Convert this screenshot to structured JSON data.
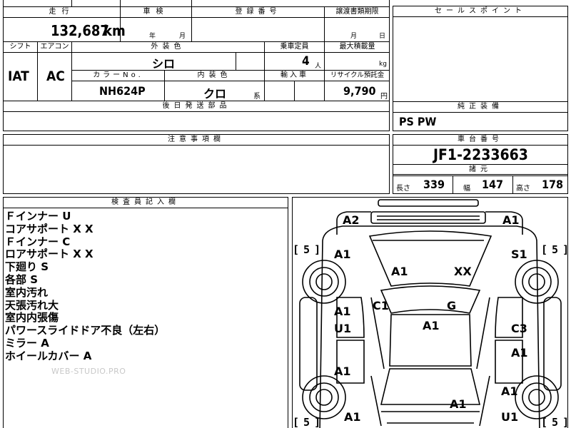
{
  "sheet": {
    "labels": {
      "mileage": "走行",
      "inspection": "車検",
      "registration": "登録番号",
      "transfer_deadline": "譲渡書類期限",
      "sales_point": "セールスポイント",
      "shift": "シフト",
      "aircon": "エアコン",
      "exterior_color": "外装色",
      "capacity": "乗車定員",
      "max_load": "最大積載量",
      "color_no": "カラーNo.",
      "interior_color": "内装色",
      "import": "輸入車",
      "recycle": "リサイクル預託金",
      "later_parts": "後日発送部品",
      "equipment": "純正装備",
      "notes": "注意事項欄",
      "chassis": "車台番号",
      "specs": "諸元",
      "inspector": "検査員記入欄"
    },
    "units": {
      "year": "年",
      "month": "月",
      "month2": "月",
      "day": "日",
      "persons": "人",
      "kg": "kg",
      "yen": "円",
      "series": "系",
      "length": "長さ",
      "width": "幅",
      "height": "高さ"
    },
    "values": {
      "mileage": "132,687",
      "mileage_unit": "km",
      "shift": "IAT",
      "aircon": "AC",
      "exterior_color": "シロ",
      "capacity": "4",
      "color_no": "NH624P",
      "interior_color": "クロ",
      "recycle": "9,790",
      "equipment": "PS PW",
      "chassis": "JF1-2233663",
      "length": "339",
      "width": "147",
      "height": "178"
    },
    "remarks": [
      "Ｆインナー U",
      "コアサポート X X",
      "Ｆインナー C",
      "ロアサポート X X",
      "下廻り S",
      "各部 S",
      "室内汚れ",
      "天張汚れ大",
      "室内内張傷",
      "パワースライドドア不良（左右）",
      "ミラー A",
      "ホイールカバー A"
    ],
    "watermark": "WEB-STUDIO.PRO"
  },
  "diagram": {
    "marks": {
      "front_left": "A2",
      "front_right": "A1",
      "hood": "A1",
      "hood_right": "XX",
      "lf_fender": "A1",
      "rf_fender": "S1",
      "left_pillar": "C1",
      "windshield": "G",
      "roof": "A1",
      "lf_door": "A1",
      "lf_door2": "U1",
      "rf_door": "C3",
      "lr_door": "A1",
      "rr_door": "A1",
      "rr_quarter": "A1",
      "rear_glass": "A1",
      "lr_quarter": "A1",
      "rear_right": "U1"
    },
    "tire_left_top": "5",
    "tire_right_top": "5",
    "tire_left_bottom": "5",
    "tire_right_bottom": "5"
  }
}
